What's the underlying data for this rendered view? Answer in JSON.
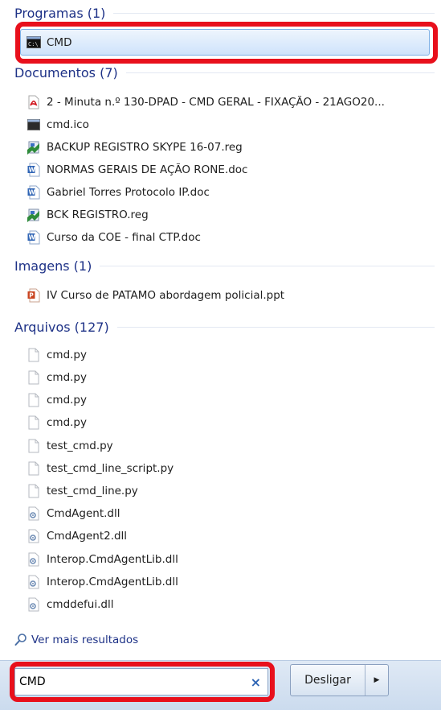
{
  "groups": {
    "programs": {
      "title": "Programas (1)",
      "items": [
        {
          "label": "CMD",
          "icon": "cmd-console-icon"
        }
      ]
    },
    "documents": {
      "title": "Documentos (7)",
      "items": [
        {
          "label": "2 - Minuta  n.º 130-DPAD - CMD GERAL - FIXAÇÃO - 21AGO20...",
          "icon": "pdf-icon"
        },
        {
          "label": "cmd.ico",
          "icon": "ico-file-icon"
        },
        {
          "label": "BACKUP REGISTRO SKYPE 16-07.reg",
          "icon": "registry-file-icon"
        },
        {
          "label": "NORMAS GERAIS DE AÇÃO RONE.doc",
          "icon": "word-doc-icon"
        },
        {
          "label": "Gabriel Torres Protocolo IP.doc",
          "icon": "word-doc-icon"
        },
        {
          "label": "BCK REGISTRO.reg",
          "icon": "registry-file-icon"
        },
        {
          "label": "Curso da COE - final CTP.doc",
          "icon": "word-doc-icon"
        }
      ]
    },
    "images": {
      "title": "Imagens (1)",
      "items": [
        {
          "label": "IV Curso de PATAMO abordagem policial.ppt",
          "icon": "powerpoint-icon"
        }
      ]
    },
    "files": {
      "title": "Arquivos (127)",
      "items": [
        {
          "label": "cmd.py",
          "icon": "blank-file-icon"
        },
        {
          "label": "cmd.py",
          "icon": "blank-file-icon"
        },
        {
          "label": "cmd.py",
          "icon": "blank-file-icon"
        },
        {
          "label": "cmd.py",
          "icon": "blank-file-icon"
        },
        {
          "label": "test_cmd.py",
          "icon": "blank-file-icon"
        },
        {
          "label": "test_cmd_line_script.py",
          "icon": "blank-file-icon"
        },
        {
          "label": "test_cmd_line.py",
          "icon": "blank-file-icon"
        },
        {
          "label": "CmdAgent.dll",
          "icon": "dll-file-icon"
        },
        {
          "label": "CmdAgent2.dll",
          "icon": "dll-file-icon"
        },
        {
          "label": "Interop.CmdAgentLib.dll",
          "icon": "dll-file-icon"
        },
        {
          "label": "Interop.CmdAgentLib.dll",
          "icon": "dll-file-icon"
        },
        {
          "label": "cmddefui.dll",
          "icon": "dll-file-icon"
        }
      ]
    }
  },
  "more_results": {
    "label": "Ver mais resultados",
    "icon": "search-icon"
  },
  "search": {
    "value": "CMD",
    "clear_icon": "clear-x-icon"
  },
  "shutdown": {
    "label": "Desligar",
    "arrow_icon": "arrow-right-icon"
  },
  "colors": {
    "highlight": "#e8101c",
    "group_title": "#1e3287",
    "selection": "#cfe3fb"
  }
}
